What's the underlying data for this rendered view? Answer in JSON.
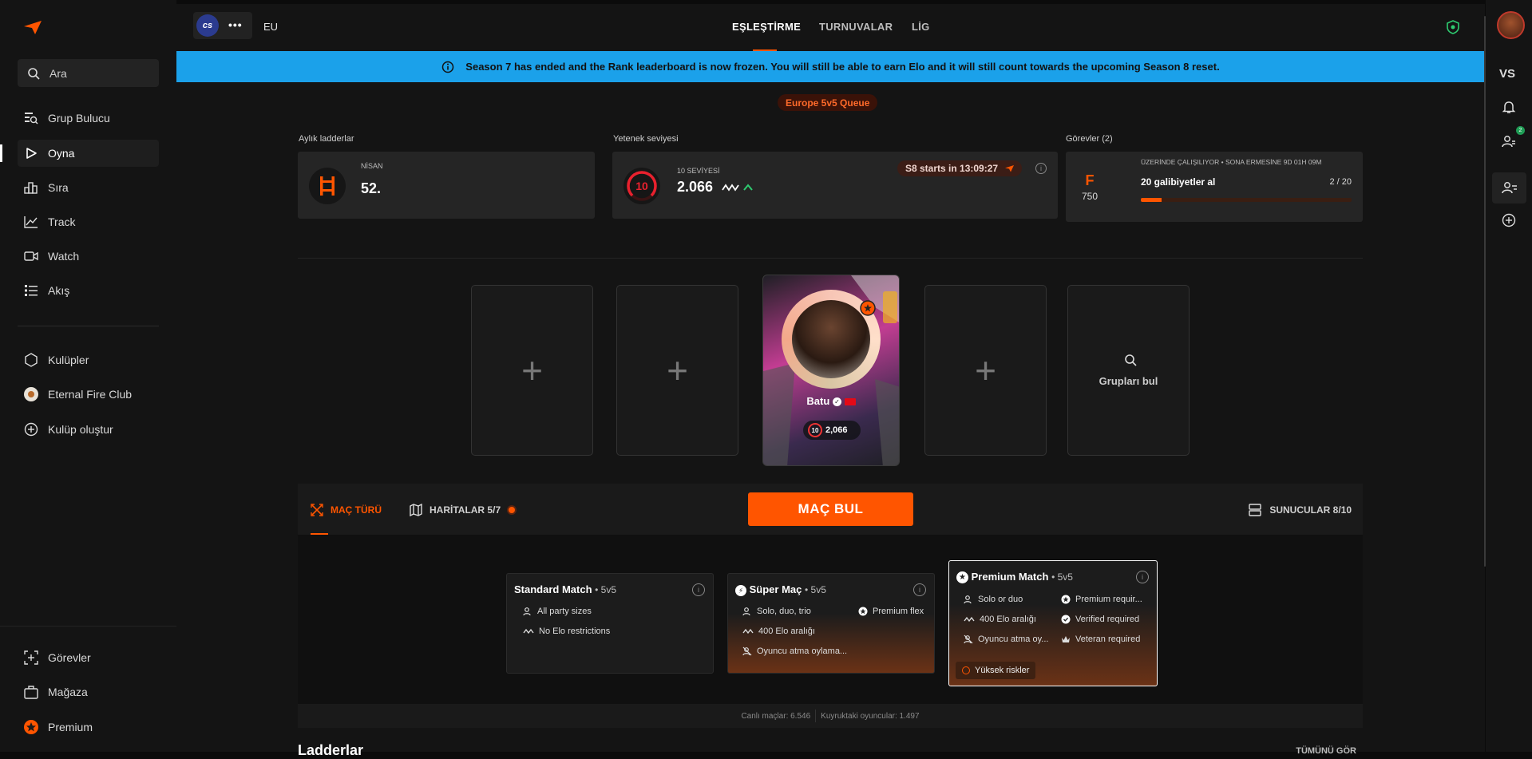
{
  "sidebar": {
    "search_placeholder": "Ara",
    "items": [
      {
        "label": "Grup Bulucu",
        "icon": "group-search-icon"
      },
      {
        "label": "Oyna",
        "icon": "play-icon"
      },
      {
        "label": "Sıra",
        "icon": "ranking-icon"
      },
      {
        "label": "Track",
        "icon": "chart-line-icon"
      },
      {
        "label": "Watch",
        "icon": "video-icon"
      },
      {
        "label": "Akış",
        "icon": "feed-icon"
      }
    ],
    "clubs": [
      {
        "label": "Kulüpler",
        "icon": "clubs-icon"
      },
      {
        "label": "Eternal Fire Club",
        "icon": "club-logo-icon"
      },
      {
        "label": "Kulüp oluştur",
        "icon": "plus-circle-icon"
      }
    ],
    "bottom": [
      {
        "label": "Görevler",
        "icon": "missions-icon"
      },
      {
        "label": "Mağaza",
        "icon": "shop-icon"
      },
      {
        "label": "Premium",
        "icon": "premium-icon"
      }
    ]
  },
  "topbar": {
    "game_badge": "cs",
    "more": "•••",
    "region": "EU",
    "tabs": [
      "EŞLEŞTİRME",
      "TURNUVALAR",
      "LİG"
    ]
  },
  "banner": {
    "text": "Season 7 has ended and the Rank leaderboard is now frozen. You will still be able to earn Elo and it will still count towards the upcoming Season 8 reset."
  },
  "queue": {
    "label": "Europe 5v5 Queue"
  },
  "ladders": {
    "section": "Aylık ladderlar",
    "month": "NİSAN",
    "rank": "52."
  },
  "skill": {
    "section": "Yetenek seviyesi",
    "level_caption": "10 SEVİYESİ",
    "level": "10",
    "elo": "2.066",
    "season_timer": "S8 starts in 13:09:27"
  },
  "missions": {
    "section": "Görevler (2)",
    "caption": "ÜZERİNDE ÇALIŞILIYOR • SONA ERMESİNE 9D 01H 09M",
    "letter": "F",
    "points": "750",
    "title": "20 galibiyetler al",
    "progress_text": "2 / 20",
    "progress": 0.1
  },
  "party": {
    "player_name": "Batu",
    "player_level": "10",
    "player_elo": "2,066",
    "find_groups": "Grupları bul",
    "add": "+"
  },
  "matchpanel": {
    "tab_match_type": "MAÇ TÜRÜ",
    "tab_maps": "HARİTALAR 5/7",
    "find_match": "MAÇ BUL",
    "servers": "SUNUCULAR 8/10",
    "cards": [
      {
        "title": "Standard Match",
        "mode": "• 5v5",
        "features": [
          "All party sizes",
          "No Elo restrictions"
        ]
      },
      {
        "title": "Süper Maç",
        "mode": "• 5v5",
        "features": [
          "Solo, duo, trio",
          "400 Elo aralığı",
          "Oyuncu atma oylama..."
        ],
        "extra": "Premium flex"
      },
      {
        "title": "Premium Match",
        "mode": "• 5v5",
        "features_left": [
          "Solo or duo",
          "400 Elo aralığı",
          "Oyuncu atma oy..."
        ],
        "features_right": [
          "Premium requir...",
          "Verified required",
          "Veteran required"
        ],
        "risk": "Yüksek riskler"
      }
    ],
    "live_matches": "Canlı maçlar: 6.546",
    "queued_players": "Kuyruktaki oyuncular: 1.497"
  },
  "ladders_section": {
    "title": "Ladderlar",
    "see_all": "TÜMÜNÜ GÖR"
  },
  "rightbar": {
    "vs": "VS",
    "friends_badge": "2"
  },
  "colors": {
    "accent": "#ff5500",
    "banner": "#1ba1ea",
    "bg": "#141414"
  }
}
